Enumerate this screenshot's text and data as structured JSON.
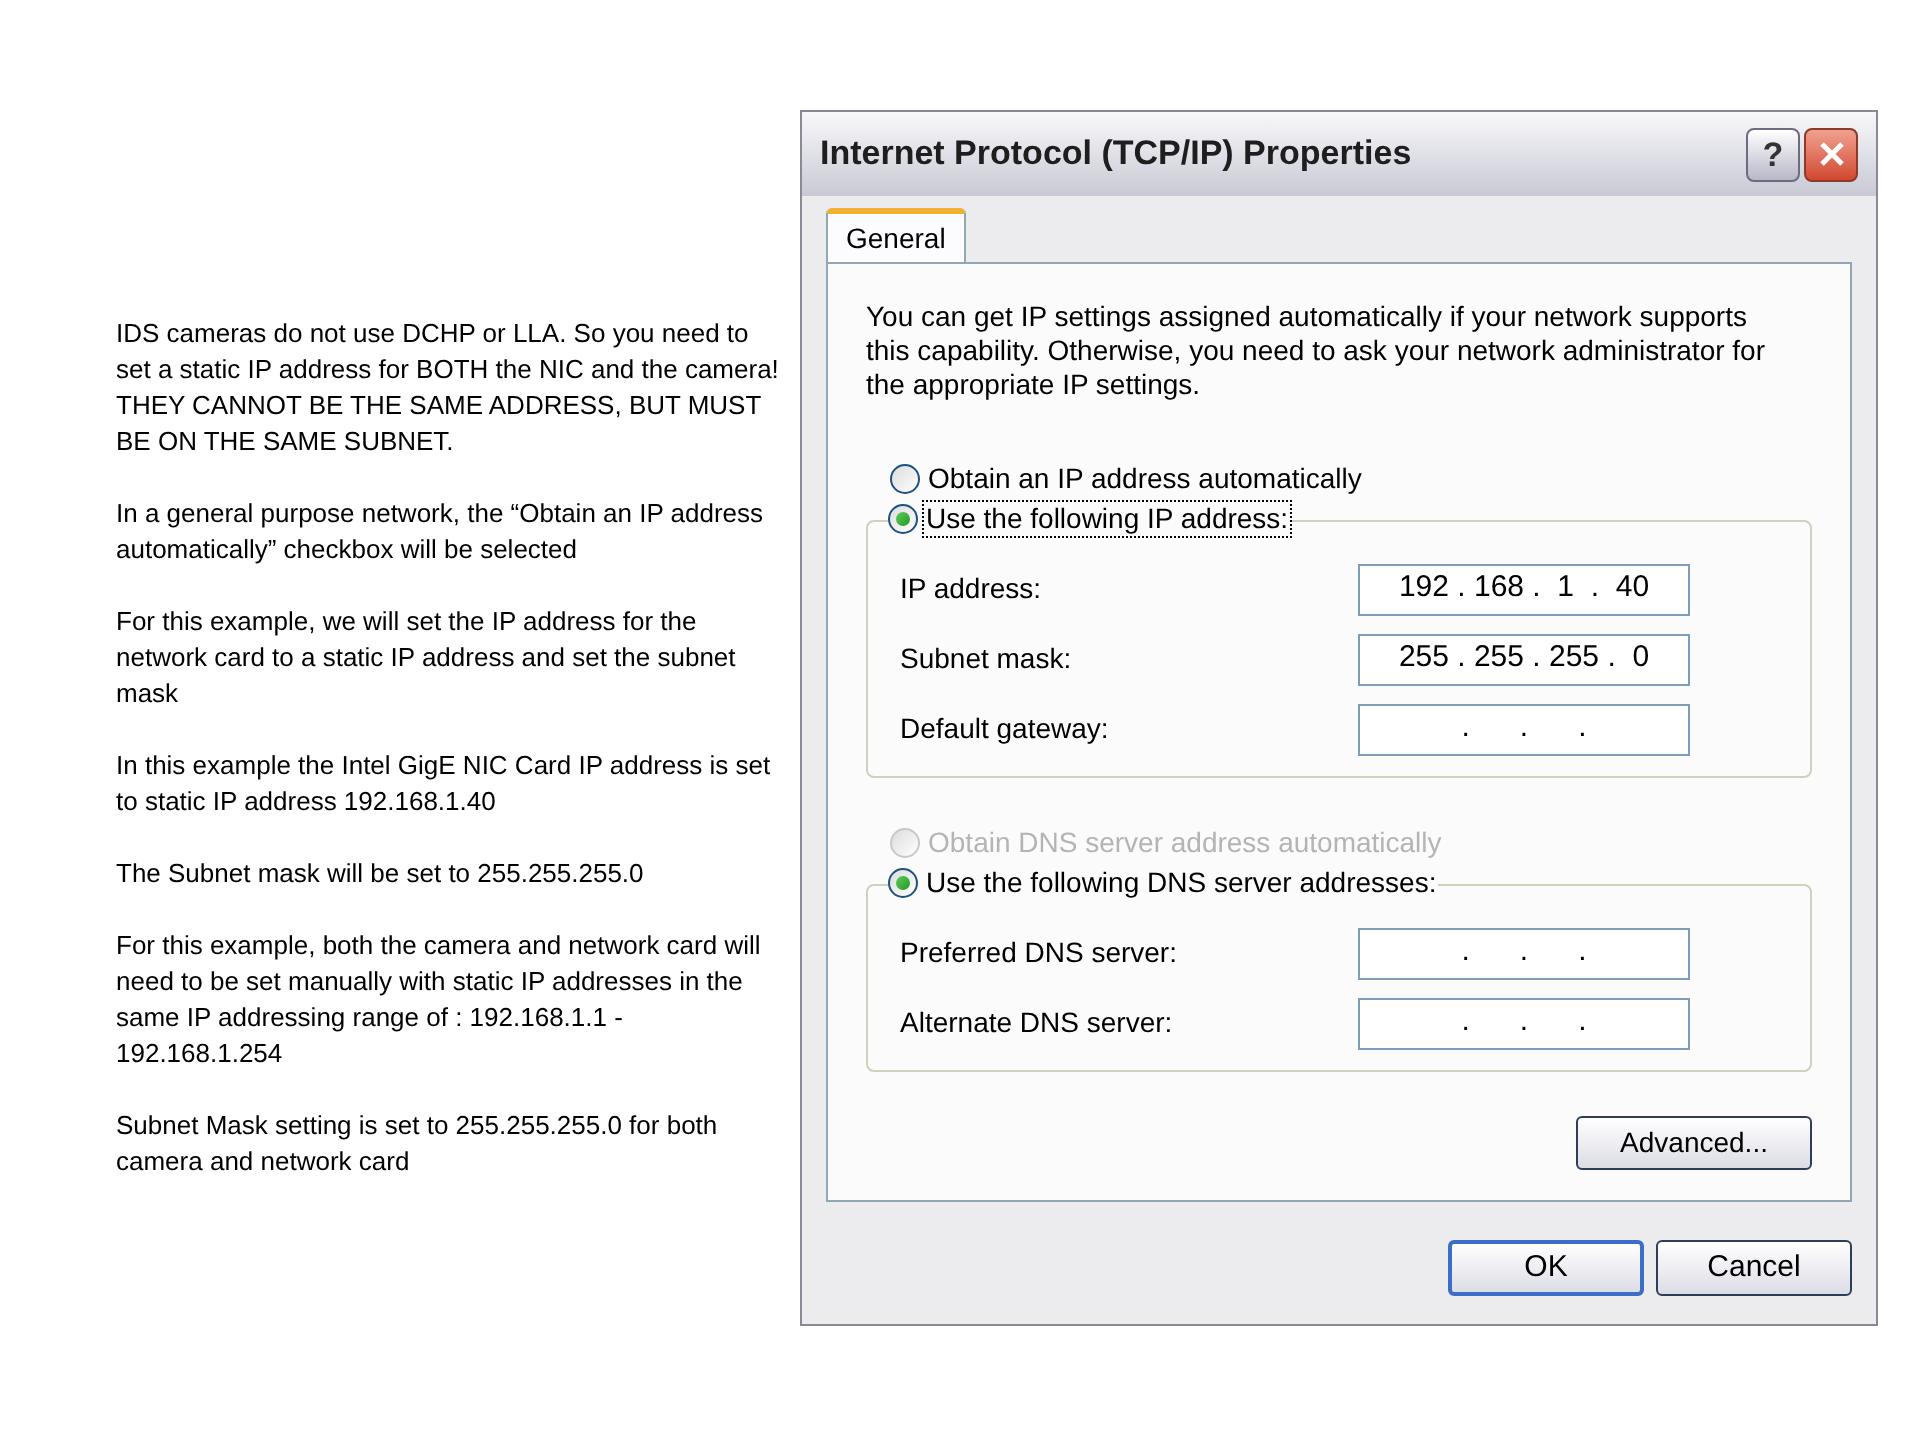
{
  "notes": [
    "IDS cameras do not use DCHP or LLA. So you need to set a static IP address  for BOTH the NIC and the camera! THEY CANNOT BE THE SAME ADDRESS, BUT MUST BE ON THE SAME SUBNET.",
    "In a general purpose network, the “Obtain an IP address automatically” checkbox will be selected",
    "For this example, we will set the IP address for the network card to a static IP address and set the subnet mask",
    "In this example the Intel GigE NIC Card IP address is set to static IP address 192.168.1.40",
    "The Subnet mask will be set to 255.255.255.0",
    "For this example, both the camera and network card will need to be set manually with static IP addresses in the same IP addressing range of : 192.168.1.1  - 192.168.1.254",
    "Subnet Mask setting is set to 255.255.255.0  for both camera and network card"
  ],
  "dialog": {
    "title": "Internet Protocol (TCP/IP) Properties",
    "help_button": "?",
    "tabs": [
      {
        "label": "General",
        "selected": true
      }
    ],
    "intro": "You can get IP settings assigned automatically if your network supports this capability. Otherwise, you need to ask your network administrator for the appropriate IP settings.",
    "ip_options": [
      {
        "label": "Obtain an IP address automatically",
        "selected": false,
        "disabled": false,
        "focused": false
      },
      {
        "label": "Use the following IP address:",
        "selected": true,
        "disabled": false,
        "focused": true
      }
    ],
    "ip_fields": [
      {
        "label": "IP address:",
        "value": "192 . 168 .  1  .  40"
      },
      {
        "label": "Subnet mask:",
        "value": "255 . 255 . 255 .  0"
      },
      {
        "label": "Default gateway:",
        "value": " .      .      . "
      }
    ],
    "dns_options": [
      {
        "label": "Obtain DNS server address automatically",
        "selected": false,
        "disabled": true,
        "focused": false
      },
      {
        "label": "Use the following DNS server addresses:",
        "selected": true,
        "disabled": false,
        "focused": false
      }
    ],
    "dns_fields": [
      {
        "label": "Preferred DNS server:",
        "value": " .      .      . "
      },
      {
        "label": "Alternate DNS server:",
        "value": " .      .      . "
      }
    ],
    "advanced_button": "Advanced...",
    "buttons": [
      {
        "label": "OK",
        "default": true
      },
      {
        "label": "Cancel",
        "default": false
      }
    ]
  }
}
